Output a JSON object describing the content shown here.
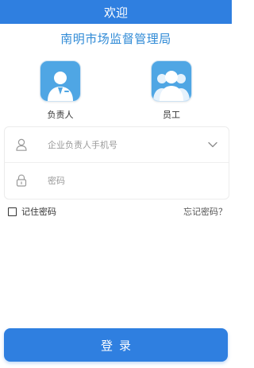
{
  "header": {
    "title": "欢迎"
  },
  "agency": {
    "name": "南明市场监督管理局"
  },
  "roles": [
    {
      "label": "负责人",
      "icon": "manager-avatar-icon"
    },
    {
      "label": "员工",
      "icon": "staff-group-icon"
    }
  ],
  "form": {
    "phone": {
      "placeholder": "企业负责人手机号",
      "value": "",
      "icon": "user-icon"
    },
    "password": {
      "placeholder": "密码",
      "value": "",
      "icon": "lock-icon"
    }
  },
  "remember": {
    "label": "记住密码",
    "checked": false
  },
  "forgot": {
    "label": "忘记密码？"
  },
  "login": {
    "label": "登录"
  },
  "colors": {
    "primary": "#2f7fe0",
    "agency_text": "#2f8ad6",
    "tile": "#4fa6e4"
  }
}
